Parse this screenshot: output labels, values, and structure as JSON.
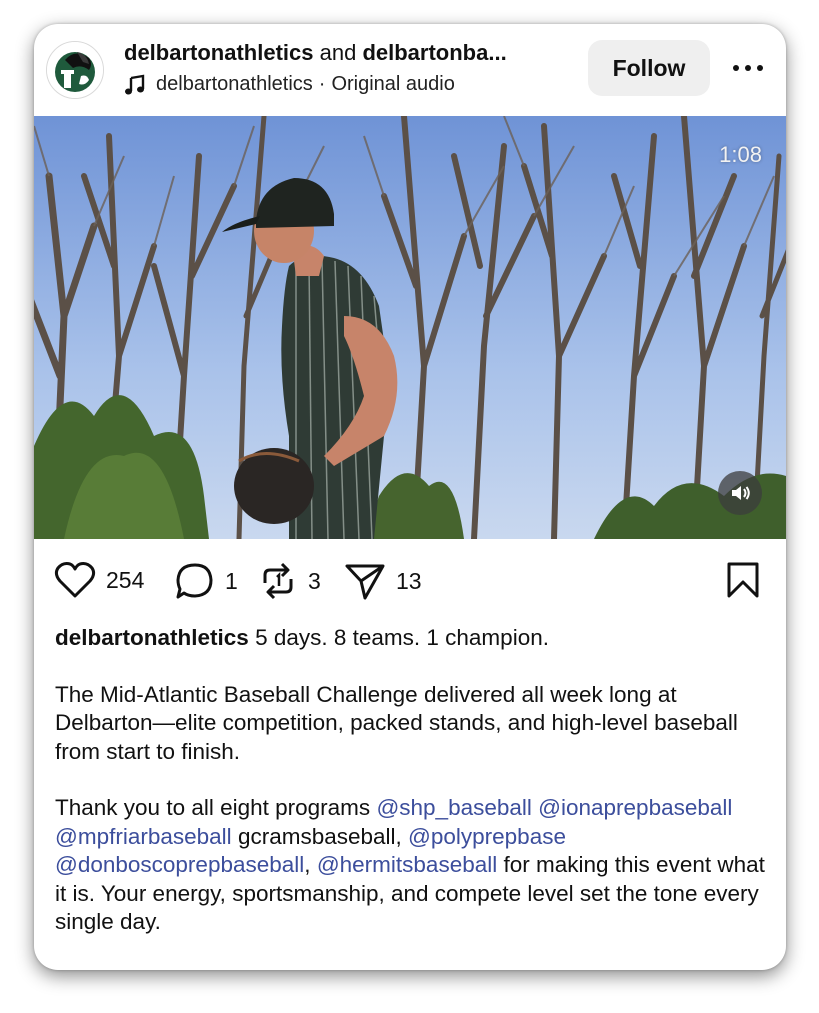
{
  "post": {
    "author_primary": "delbartonathletics",
    "joiner": "and",
    "author_secondary": "delbartonba...",
    "audio_author": "delbartonathletics",
    "audio_separator": "·",
    "audio_label": "Original audio",
    "follow_label": "Follow",
    "more_icon": "more-horizontal-icon"
  },
  "video": {
    "duration": "1:08",
    "mute_icon": "volume-icon"
  },
  "actions": {
    "likes": "254",
    "comments": "1",
    "reposts": "3",
    "shares": "13"
  },
  "caption": {
    "username": "delbartonathletics",
    "headline": "5 days. 8 teams. 1 champion.",
    "paragraph1": "The Mid-Atlantic Baseball Challenge delivered all week long at Delbarton—elite competition, packed stands, and high-level baseball from start to finish.",
    "p2_intro": "Thank you to all eight programs",
    "mention1": "@shp_baseball",
    "mention2": "@ionaprepbaseball",
    "mention3": "@mpfriarbaseball",
    "plain1": "gcramsbaseball,",
    "mention4": "@polyprepbase",
    "mention5": "@donboscoprepbaseball",
    "comma": ",",
    "mention6": "@hermitsbaseball",
    "p2_outro": "for making this event what it is. Your energy, sportsmanship, and compete level set the tone every single day."
  },
  "colors": {
    "mention": "#3c4e9c",
    "follow_bg": "#efefef",
    "brand_green": "#1f5a3c"
  }
}
